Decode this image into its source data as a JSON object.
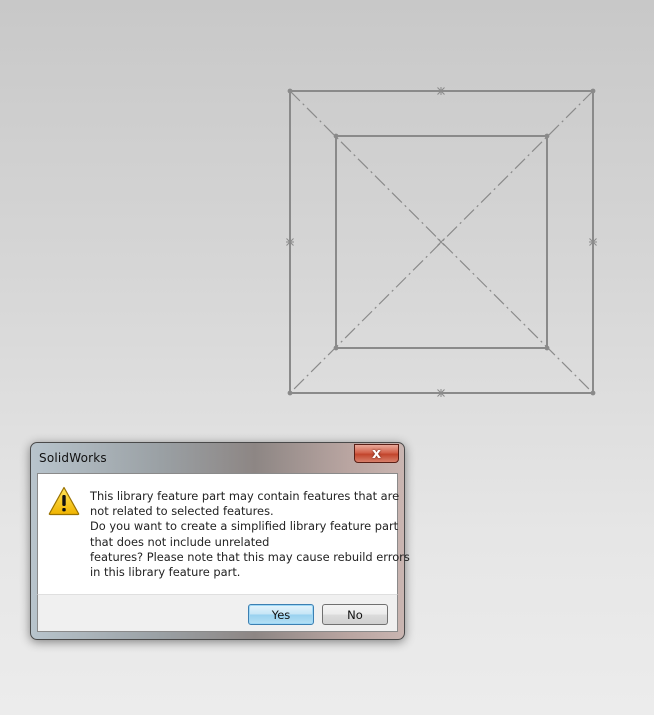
{
  "dialog": {
    "title": "SolidWorks",
    "close_label": "x",
    "message_lines": [
      "This library feature part may contain features that are",
      "not related to selected features.",
      "Do you want to create a simplified library feature part",
      "that does not include unrelated",
      "features?  Please note that this may cause rebuild errors",
      "in this library feature part."
    ],
    "yes_label": "Yes",
    "no_label": "No",
    "icon": "warning-icon"
  },
  "colors": {
    "sketch_line": "#8a8a8a",
    "warning_fill": "#f5c400",
    "close_red": "#c2452c",
    "default_button_border": "#3c7fb1"
  }
}
